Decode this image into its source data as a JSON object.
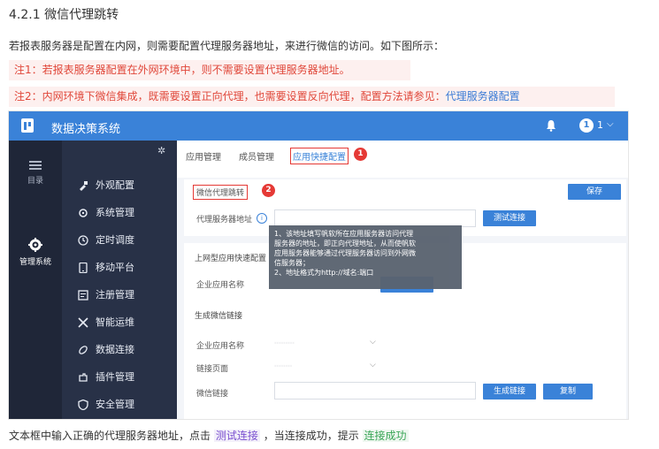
{
  "heading": "4.2.1 微信代理跳转",
  "intro": "若报表服务器是配置在内网，则需要配置代理服务器地址，来进行微信的访问。如下图所示：",
  "notes": {
    "note1": "注1：若报表服务器配置在外网环境中，则不需要设置代理服务器地址。",
    "note2_text": "注2：内网环境下微信集成，既需要设置正向代理，也需要设置反向代理，配置方法请参见：",
    "note2_link": "代理服务器配置"
  },
  "app": {
    "title": "数据决策系统",
    "user_avatar": "1",
    "user_name": "1",
    "colors": {
      "topbar": "#3a82d8",
      "leftbar": "#1f2638",
      "menu": "#283147",
      "accent": "#3a82d8",
      "annotation": "#e53935"
    }
  },
  "leftbar": {
    "items": [
      {
        "icon": "list-icon",
        "label": "目录"
      },
      {
        "icon": "gear-icon",
        "label": "管理系统"
      }
    ]
  },
  "menu": {
    "items": [
      {
        "icon": "brush-icon",
        "label": "外观配置"
      },
      {
        "icon": "settings-icon",
        "label": "系统管理"
      },
      {
        "icon": "clock-icon",
        "label": "定时调度"
      },
      {
        "icon": "mobile-icon",
        "label": "移动平台"
      },
      {
        "icon": "register-icon",
        "label": "注册管理"
      },
      {
        "icon": "ops-icon",
        "label": "智能运维"
      },
      {
        "icon": "link-icon",
        "label": "数据连接"
      },
      {
        "icon": "plugin-icon",
        "label": "插件管理"
      },
      {
        "icon": "shield-icon",
        "label": "安全管理"
      }
    ]
  },
  "tabs": [
    {
      "label": "应用管理"
    },
    {
      "label": "成员管理"
    },
    {
      "label": "应用快捷配置"
    }
  ],
  "badges": {
    "one": "1",
    "two": "2"
  },
  "proxy_section": {
    "title": "微信代理跳转",
    "save_button": "保存",
    "proxy_label": "代理服务器地址",
    "info_icon": "i",
    "test_button": "测试连接"
  },
  "tooltip": {
    "lines": [
      "1、该地址填写帆软所在应用服务器访问代理",
      "服务器的地址，即正向代理地址，从而使帆软",
      "应用服务器能够通过代理服务器访问到外网微",
      "信服务器；",
      "2、地址格式为http://域名:端口"
    ]
  },
  "quick_section": {
    "title": "上网型应用快速配置",
    "app_name_label": "企业应用名称"
  },
  "link_section": {
    "title": "生成微信链接",
    "app_label": "企业应用名称",
    "app_value": "·········",
    "page_label": "链接页面",
    "page_value": "········",
    "link_label": "微信链接",
    "generate_button": "生成链接",
    "copy_button": "复制"
  },
  "bottom": {
    "text1": "文本框中输入正确的代理服务器地址，点击",
    "link1": "测试连接",
    "text2": "，当连接成功，提示",
    "link2": "连接成功"
  }
}
